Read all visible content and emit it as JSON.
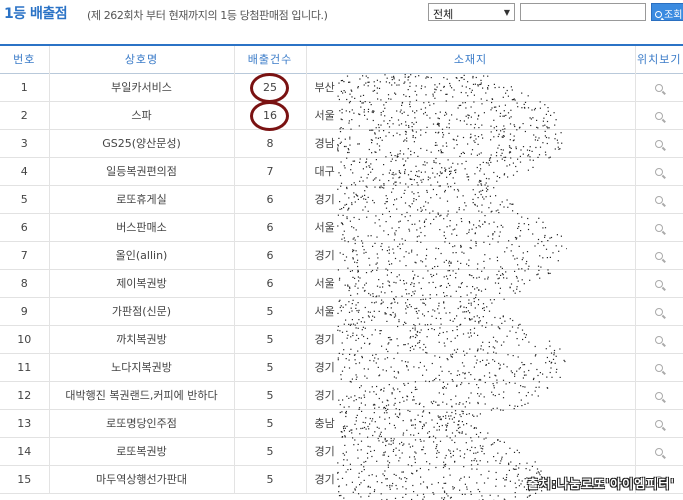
{
  "header": {
    "title": "1등 배출점",
    "subtitle": "(제 262회차 부터 현재까지의 1등 당첨판매점 입니다.)",
    "region_select": "전체",
    "search_value": "",
    "search_button": "조회"
  },
  "table": {
    "columns": [
      "번호",
      "상호명",
      "배출건수",
      "소재지",
      "위치보기"
    ],
    "rows": [
      {
        "no": "1",
        "name": "부일카서비스",
        "count": "25",
        "addr": "부산"
      },
      {
        "no": "2",
        "name": "스파",
        "count": "16",
        "addr": "서울"
      },
      {
        "no": "3",
        "name": "GS25(양산문성)",
        "count": "8",
        "addr": "경남"
      },
      {
        "no": "4",
        "name": "일등복권편의점",
        "count": "7",
        "addr": "대구"
      },
      {
        "no": "5",
        "name": "로또휴게실",
        "count": "6",
        "addr": "경기"
      },
      {
        "no": "6",
        "name": "버스판매소",
        "count": "6",
        "addr": "서울"
      },
      {
        "no": "7",
        "name": "올인(allin)",
        "count": "6",
        "addr": "경기"
      },
      {
        "no": "8",
        "name": "제이복권방",
        "count": "6",
        "addr": "서울"
      },
      {
        "no": "9",
        "name": "가판점(신문)",
        "count": "5",
        "addr": "서울"
      },
      {
        "no": "10",
        "name": "까치복권방",
        "count": "5",
        "addr": "경기"
      },
      {
        "no": "11",
        "name": "노다지복권방",
        "count": "5",
        "addr": "경기"
      },
      {
        "no": "12",
        "name": "대박행진 복권랜드,커피에 반하다",
        "count": "5",
        "addr": "경기"
      },
      {
        "no": "13",
        "name": "로또명당인주점",
        "count": "5",
        "addr": "충남"
      },
      {
        "no": "14",
        "name": "로또복권방",
        "count": "5",
        "addr": "경기"
      },
      {
        "no": "15",
        "name": "마두역상행선가판대",
        "count": "5",
        "addr": "경기"
      }
    ]
  },
  "watermark": "출처:나눔로또'아이엠피터'",
  "colors": {
    "accent": "#2b73c6",
    "highlight_circle": "#7a1212"
  },
  "icons": {
    "location": "magnifier-icon"
  }
}
